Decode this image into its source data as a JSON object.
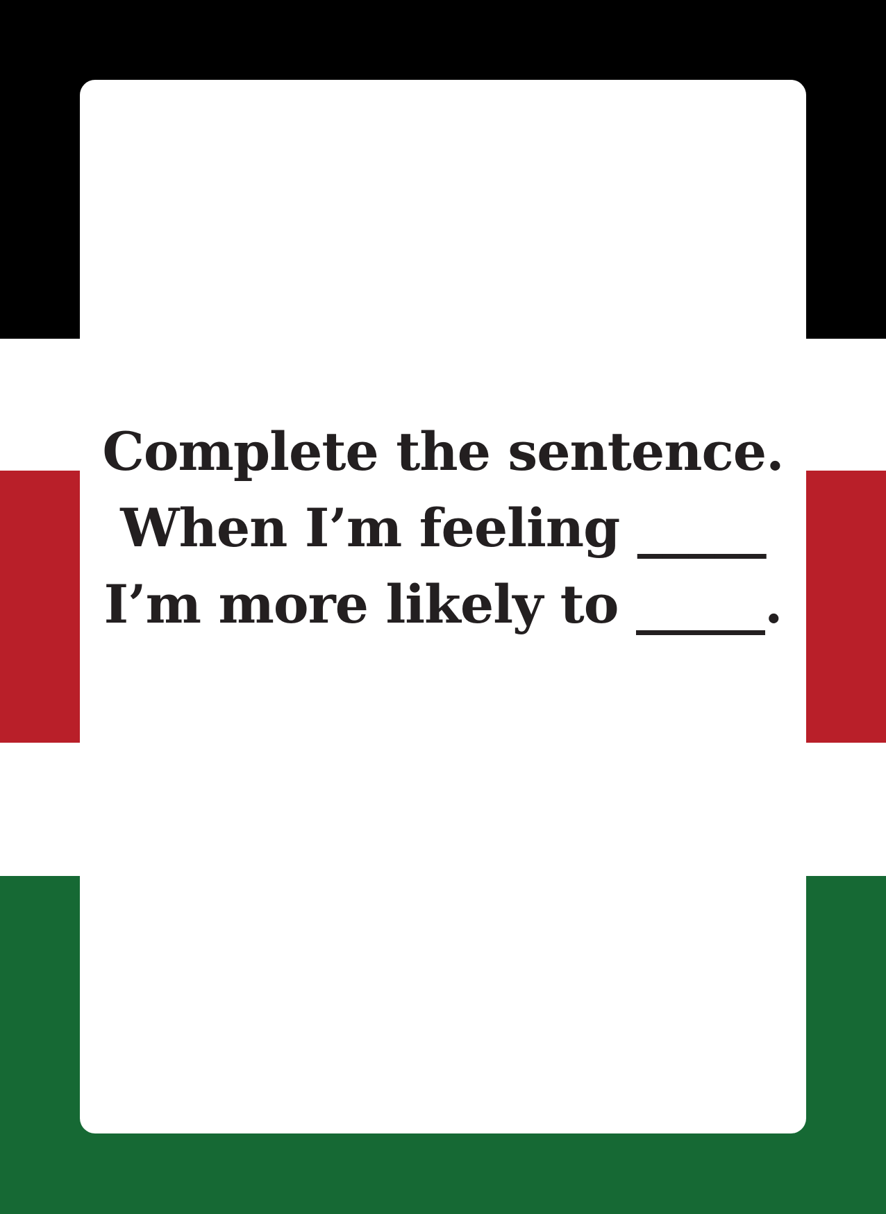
{
  "colors": {
    "band_top": "#000000",
    "band_middle": "#b91f29",
    "band_bottom": "#166934",
    "band_separator": "#ffffff",
    "card_background": "#ffffff",
    "text": "#231f20"
  },
  "card": {
    "lines": [
      "Complete the sentence.",
      "When I’m feeling _____",
      "I’m more likely to _____."
    ]
  }
}
